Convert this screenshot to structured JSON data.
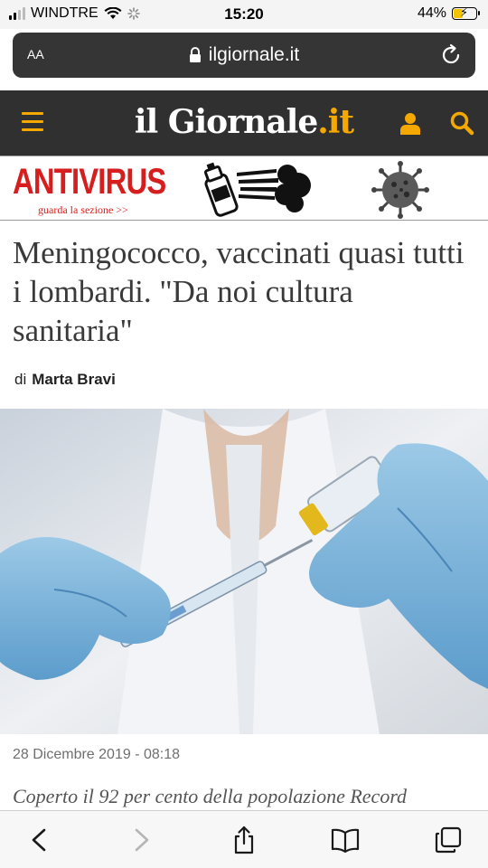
{
  "status_bar": {
    "carrier": "WINDTRE",
    "time": "15:20",
    "battery": "44%",
    "battery_level": 0.44
  },
  "browser": {
    "text_size_label": "AA",
    "url": "ilgiornale.it"
  },
  "site_header": {
    "logo_main": "il Giornale",
    "logo_dot": ".",
    "logo_suffix": "it",
    "accent_color": "#f5a800"
  },
  "banner": {
    "title": "ANTIVIRUS",
    "subtitle": "guarda la sezione >>",
    "color": "#d71e1e"
  },
  "article": {
    "headline": "Meningococco, vaccinati quasi tutti i lombardi. \"Da noi cultura sanitaria\"",
    "byline_prefix": "di",
    "author": "Marta Bravi",
    "date": "28 Dicembre 2019 - 08:18",
    "lead": "Coperto il 92 per cento della popolazione Record"
  },
  "toolbar": {
    "icons": [
      "back-icon",
      "forward-icon",
      "share-icon",
      "bookmarks-icon",
      "tabs-icon"
    ]
  }
}
